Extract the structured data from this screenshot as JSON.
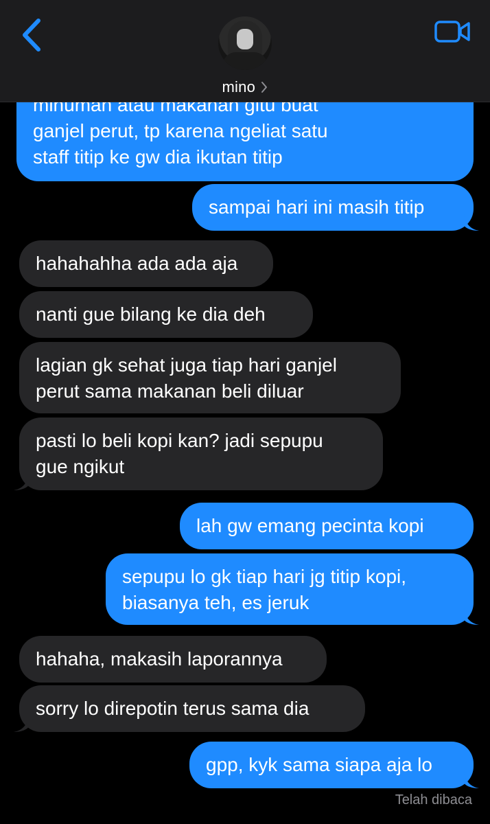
{
  "header": {
    "contact_name": "mino",
    "back_icon": "chevron-left-icon",
    "video_icon": "video-camera-icon",
    "accent_color": "#1f8bff"
  },
  "messages": [
    {
      "sender": "me",
      "lines": [
        "minuman atau makanan gitu buat",
        "ganjel perut, tp karena ngeliat satu",
        "staff titip ke gw dia ikutan titip"
      ]
    },
    {
      "sender": "me",
      "lines": [
        "sampai hari ini masih titip"
      ]
    },
    {
      "sender": "them",
      "lines": [
        "hahahahha ada ada aja"
      ]
    },
    {
      "sender": "them",
      "lines": [
        "nanti gue bilang ke dia deh"
      ]
    },
    {
      "sender": "them",
      "lines": [
        "lagian gk sehat juga tiap hari ganjel",
        "perut sama makanan beli diluar"
      ]
    },
    {
      "sender": "them",
      "lines": [
        "pasti lo beli kopi kan? jadi sepupu",
        "gue ngikut"
      ]
    },
    {
      "sender": "me",
      "lines": [
        "lah gw emang pecinta kopi"
      ]
    },
    {
      "sender": "me",
      "lines": [
        "sepupu lo gk tiap hari jg titip kopi,",
        "biasanya teh, es jeruk"
      ]
    },
    {
      "sender": "them",
      "lines": [
        "hahaha, makasih laporannya"
      ]
    },
    {
      "sender": "them",
      "lines": [
        "sorry lo direpotin terus sama dia"
      ]
    },
    {
      "sender": "me",
      "lines": [
        "gpp, kyk sama siapa aja lo"
      ]
    }
  ],
  "read_receipt": "Telah dibaca"
}
